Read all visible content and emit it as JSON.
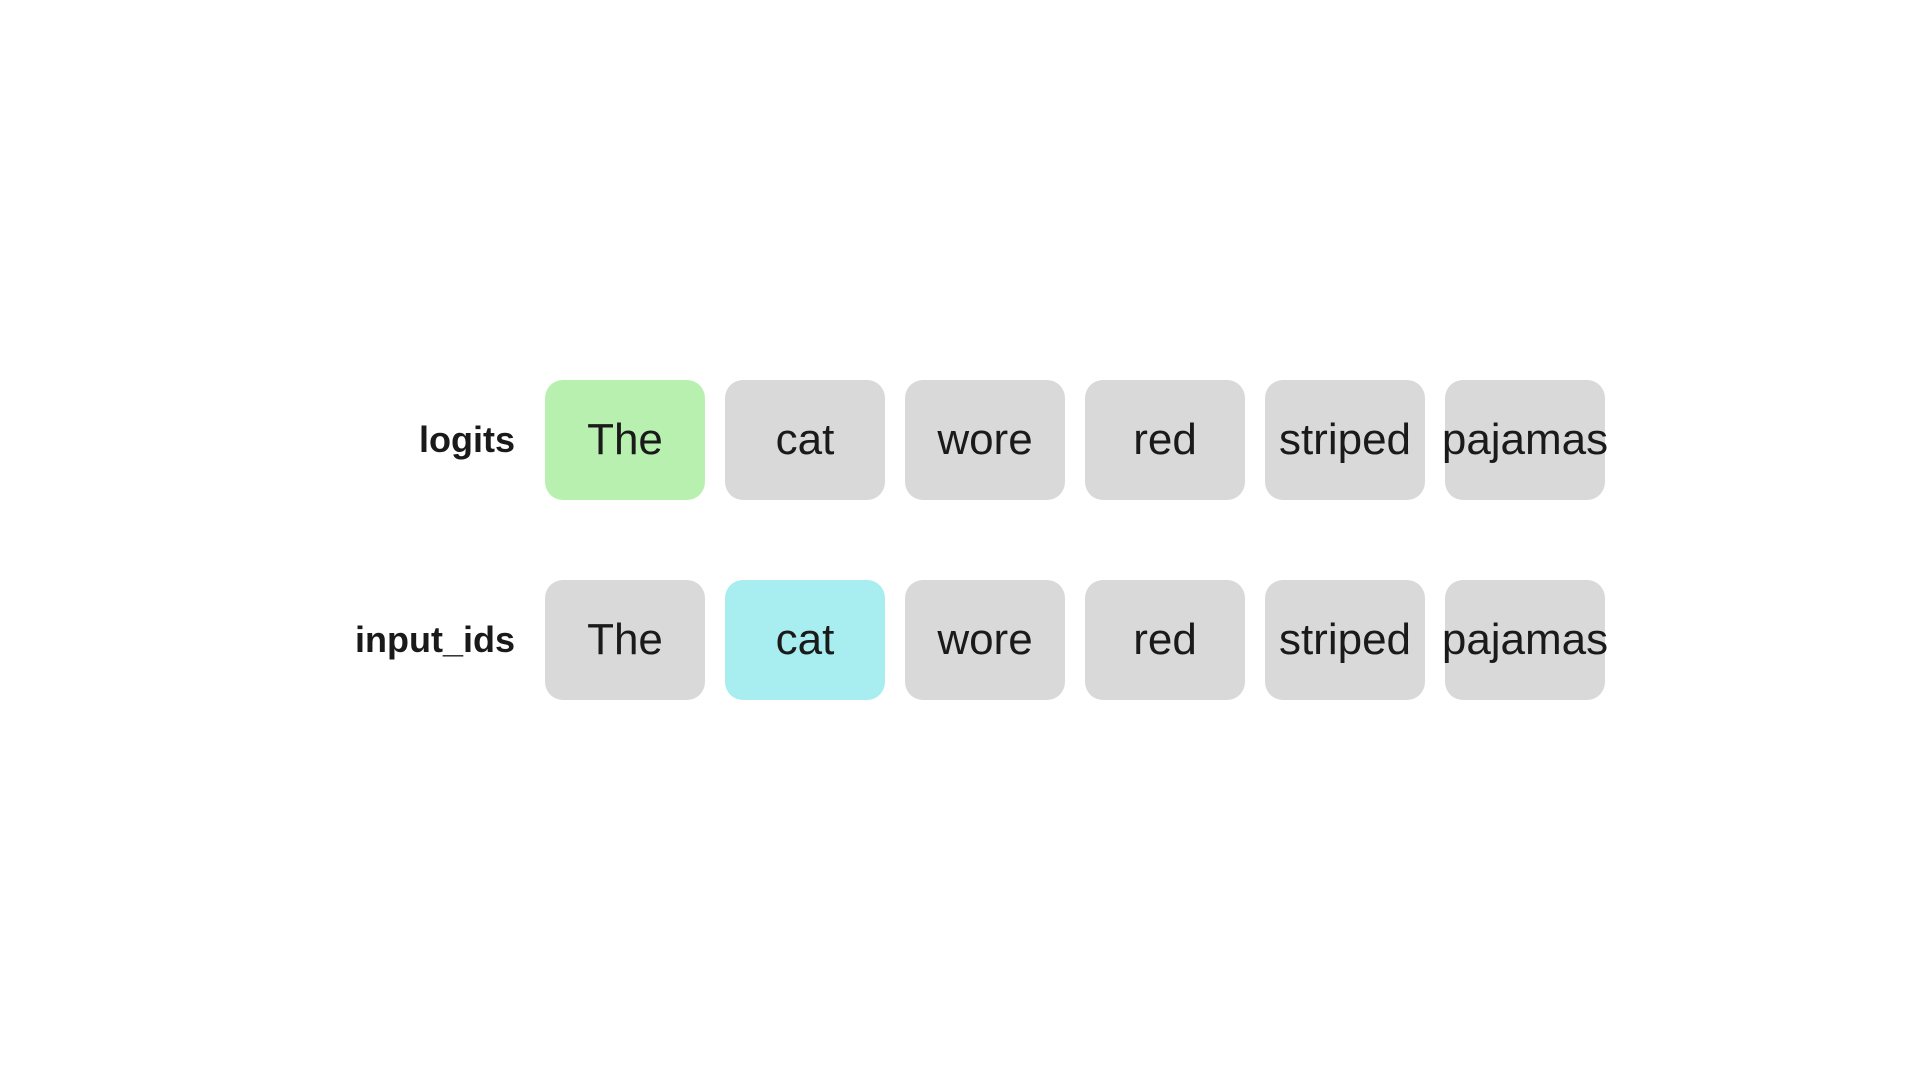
{
  "rows": [
    {
      "id": "logits",
      "label": "logits",
      "tokens": [
        {
          "text": "The",
          "highlight": "green"
        },
        {
          "text": "cat",
          "highlight": "none"
        },
        {
          "text": "wore",
          "highlight": "none"
        },
        {
          "text": "red",
          "highlight": "none"
        },
        {
          "text": "striped",
          "highlight": "none"
        },
        {
          "text": "pajamas",
          "highlight": "none"
        }
      ]
    },
    {
      "id": "input_ids",
      "label": "input_ids",
      "tokens": [
        {
          "text": "The",
          "highlight": "none"
        },
        {
          "text": "cat",
          "highlight": "cyan"
        },
        {
          "text": "wore",
          "highlight": "none"
        },
        {
          "text": "red",
          "highlight": "none"
        },
        {
          "text": "striped",
          "highlight": "none"
        },
        {
          "text": "pajamas",
          "highlight": "none"
        }
      ]
    }
  ]
}
